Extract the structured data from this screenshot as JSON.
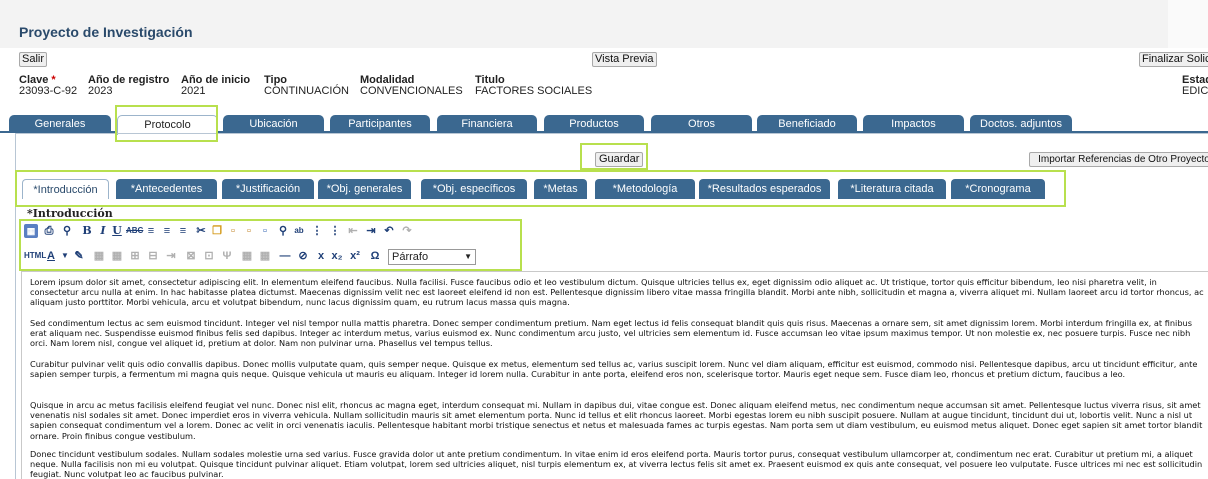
{
  "header": {
    "title": "Proyecto de Investigación"
  },
  "top_buttons": {
    "salir": "Salir",
    "vista_previa": "Vista Previa",
    "finalizar": "Finalizar Solicitud"
  },
  "info": {
    "clave_label": "Clave",
    "clave_req": "*",
    "clave_value": "23093-C-92",
    "registro_label": "Año de registro",
    "registro_value": "2023",
    "inicio_label": "Año de inicio",
    "inicio_value": "2021",
    "tipo_label": "Tipo",
    "tipo_value": "CONTINUACIÓN",
    "modalidad_label": "Modalidad",
    "modalidad_value": "CONVENCIONALES",
    "titulo_label": "Titulo",
    "titulo_value": "FACTORES SOCIALES",
    "estado_label": "Estado",
    "estado_value": "EDICIÓN"
  },
  "main_tabs": [
    "Generales",
    "Protocolo",
    "Ubicación",
    "Participantes",
    "Financiera",
    "Productos",
    "Otros",
    "Beneficiado",
    "Impactos",
    "Doctos. adjuntos"
  ],
  "active_main_tab": "Protocolo",
  "actions": {
    "guardar": "Guardar",
    "importar": "Importar Referencias de Otro Proyecto"
  },
  "sub_tabs": [
    "*Introducción",
    "*Antecedentes",
    "*Justificación",
    "*Obj. generales",
    "*Obj. específicos",
    "*Metas",
    "*Metodología",
    "*Resultados esperados",
    "*Literatura citada",
    "*Cronograma"
  ],
  "active_sub_tab": "*Introducción",
  "section_heading": "*Introducción",
  "toolbar": {
    "row1_icons": [
      "source-icon",
      "print-icon",
      "preview-icon",
      "bold-icon",
      "italic-icon",
      "underline-icon",
      "strikethrough-icon",
      "align-left-icon",
      "align-center-icon",
      "align-right-icon",
      "cut-icon",
      "copy-icon",
      "paste-icon",
      "paste-text-icon",
      "paste-word-icon",
      "find-icon",
      "replace-icon",
      "bulleted-list-icon",
      "numbered-list-icon",
      "outdent-icon",
      "indent-icon",
      "undo-icon",
      "redo-icon"
    ],
    "row2_icons": [
      "html-icon",
      "text-color-icon",
      "edit-icon",
      "table-icon",
      "table-cell-icon",
      "insert-row-icon",
      "delete-row-icon",
      "merge-cells-icon",
      "split-cells-icon",
      "subscript-icon",
      "superscript-icon",
      "hr-icon",
      "eraser-icon",
      "remove-format-icon",
      "special-char-icon"
    ],
    "format_value": "Párrafo"
  },
  "editor": {
    "paragraphs": [
      "Lorem ipsum dolor sit amet, consectetur adipiscing elit. In elementum eleifend faucibus. Nulla facilisi. Fusce faucibus odio et leo vestibulum dictum. Quisque ultricies tellus ex, eget dignissim odio aliquet ac. Ut tristique, tortor quis efficitur bibendum, leo nisi pharetra velit, in consectetur arcu nulla at enim. In hac habitasse platea dictumst. Maecenas dignissim velit nec est laoreet eleifend id non est. Pellentesque dignissim libero vitae massa fringilla blandit. Morbi ante nibh, sollicitudin et magna a, viverra aliquet mi. Nullam laoreet arcu id tortor rhoncus, ac aliquam justo porttitor. Morbi vehicula, arcu et volutpat bibendum, nunc lacus dignissim quam, eu rutrum lacus massa quis magna.",
      "Sed condimentum lectus ac sem euismod tincidunt. Integer vel nisl tempor nulla mattis pharetra. Donec semper condimentum pretium. Nam eget lectus id felis consequat blandit quis quis risus. Maecenas a ornare sem, sit amet dignissim lorem. Morbi interdum fringilla ex, at finibus erat aliquam nec. Suspendisse euismod finibus felis sed dapibus. Integer ac interdum metus, varius euismod ex. Nunc condimentum arcu justo, vel ultricies sem elementum id. Fusce accumsan leo vitae ipsum maximus tempor. Ut non molestie ex, nec posuere turpis. Fusce nec nibh orci. Nam lorem nisl, congue vel aliquet id, pretium at dolor. Nam non pulvinar urna. Phasellus vel tempus tellus.",
      "Curabitur pulvinar velit quis odio convallis dapibus. Donec mollis vulputate quam, quis semper neque. Quisque ex metus, elementum sed tellus ac, varius suscipit lorem. Nunc vel diam aliquam, efficitur est euismod, commodo nisi. Pellentesque dapibus, arcu ut tincidunt efficitur, ante sapien semper turpis, a fermentum mi magna quis neque. Quisque vehicula ut mauris eu aliquam. Integer id lorem nulla. Curabitur in ante porta, eleifend eros non, scelerisque tortor. Mauris eget neque sem. Fusce diam leo, rhoncus et pretium dictum, faucibus a leo.",
      "Quisque in arcu ac metus facilisis eleifend feugiat vel nunc. Donec nisl elit, rhoncus ac magna eget, interdum consequat mi. Nullam in dapibus dui, vitae congue est. Donec aliquam eleifend metus, nec condimentum neque accumsan sit amet. Pellentesque luctus viverra risus, sit amet venenatis nisl sodales sit amet. Donec imperdiet eros in viverra vehicula. Nullam sollicitudin mauris sit amet elementum porta. Nunc id tellus et elit rhoncus laoreet. Morbi egestas lorem eu nibh suscipit posuere. Nullam at augue tincidunt, tincidunt dui ut, lobortis velit. Nunc a nisl ut sapien consequat condimentum vel a lorem. Donec ac velit in orci venenatis iaculis. Pellentesque habitant morbi tristique senectus et netus et malesuada fames ac turpis egestas. Nam porta sem ut diam vestibulum, eu euismod metus aliquet. Donec eget sapien sit amet tortor blandit ornare. Proin finibus congue vestibulum.",
      "Donec tincidunt vestibulum sodales. Nullam sodales molestie urna sed varius. Fusce gravida dolor ut ante pretium condimentum. In vitae enim id eros eleifend porta. Mauris tortor purus, consequat vestibulum ullamcorper at, condimentum nec erat. Curabitur ut pretium mi, a aliquet neque. Nulla facilisis non mi eu volutpat. Quisque tincidunt pulvinar aliquet. Etiam volutpat, lorem sed ultricies aliquet, nisl turpis elementum ex, at viverra lectus felis sit amet ex. Praesent euismod ex quis ante consequat, vel posuere leo vulputate. Fusce ultrices mi nec est sollicitudin feugiat. Nunc volutpat leo ac faucibus pulvinar."
    ]
  },
  "colors": {
    "tab_blue": "#3b6890",
    "highlight_green": "#b8e04e",
    "title_blue": "#2a4a6b",
    "required_red": "#cc0000"
  }
}
